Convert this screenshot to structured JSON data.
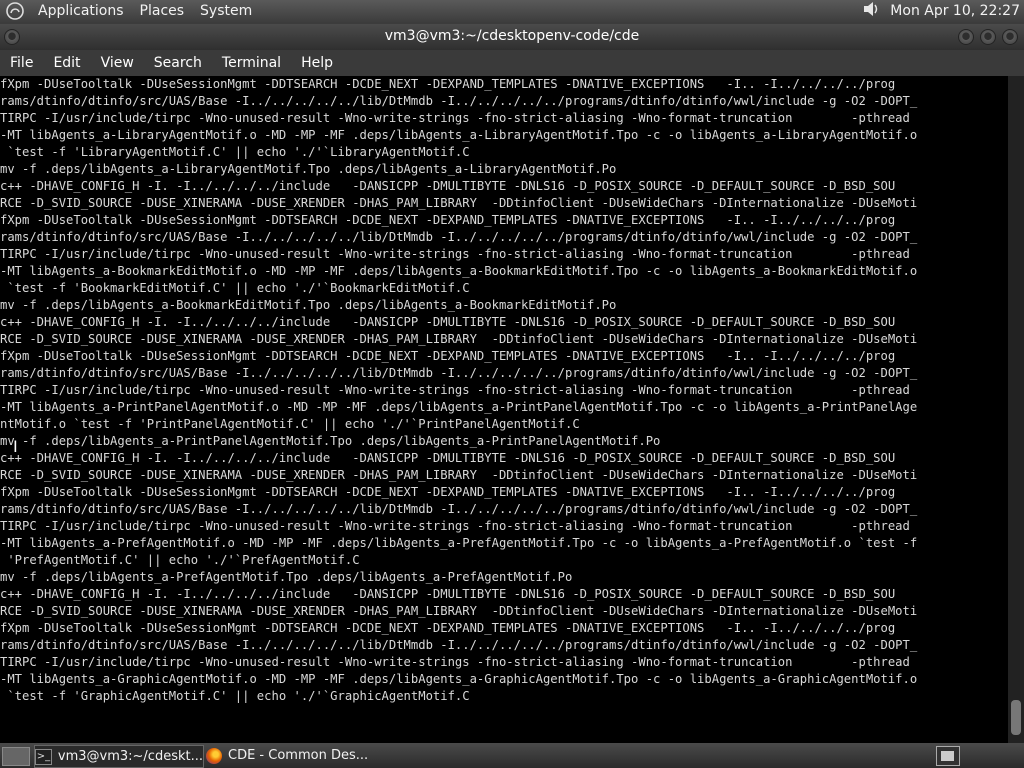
{
  "top_panel": {
    "menus": [
      "Applications",
      "Places",
      "System"
    ],
    "clock": "Mon Apr 10, 22:27"
  },
  "window": {
    "title": "vm3@vm3:~/cdesktopenv-code/cde",
    "menubar": [
      "File",
      "Edit",
      "View",
      "Search",
      "Terminal",
      "Help"
    ]
  },
  "terminal": {
    "lines": [
      "fXpm -DUseTooltalk -DUseSessionMgmt -DDTSEARCH -DCDE_NEXT -DEXPAND_TEMPLATES -DNATIVE_EXCEPTIONS   -I.. -I../../../../prog",
      "rams/dtinfo/dtinfo/src/UAS/Base -I../../../../../lib/DtMmdb -I../../../../../programs/dtinfo/dtinfo/wwl/include -g -O2 -DOPT_",
      "TIRPC -I/usr/include/tirpc -Wno-unused-result -Wno-write-strings -fno-strict-aliasing -Wno-format-truncation        -pthread",
      "-MT libAgents_a-LibraryAgentMotif.o -MD -MP -MF .deps/libAgents_a-LibraryAgentMotif.Tpo -c -o libAgents_a-LibraryAgentMotif.o",
      " `test -f 'LibraryAgentMotif.C' || echo './'`LibraryAgentMotif.C",
      "mv -f .deps/libAgents_a-LibraryAgentMotif.Tpo .deps/libAgents_a-LibraryAgentMotif.Po",
      "c++ -DHAVE_CONFIG_H -I. -I../../../../include   -DANSICPP -DMULTIBYTE -DNLS16 -D_POSIX_SOURCE -D_DEFAULT_SOURCE -D_BSD_SOU",
      "RCE -D_SVID_SOURCE -DUSE_XINERAMA -DUSE_XRENDER -DHAS_PAM_LIBRARY  -DDtinfoClient -DUseWideChars -DInternationalize -DUseMoti",
      "fXpm -DUseTooltalk -DUseSessionMgmt -DDTSEARCH -DCDE_NEXT -DEXPAND_TEMPLATES -DNATIVE_EXCEPTIONS   -I.. -I../../../../prog",
      "rams/dtinfo/dtinfo/src/UAS/Base -I../../../../../lib/DtMmdb -I../../../../../programs/dtinfo/dtinfo/wwl/include -g -O2 -DOPT_",
      "TIRPC -I/usr/include/tirpc -Wno-unused-result -Wno-write-strings -fno-strict-aliasing -Wno-format-truncation        -pthread",
      "-MT libAgents_a-BookmarkEditMotif.o -MD -MP -MF .deps/libAgents_a-BookmarkEditMotif.Tpo -c -o libAgents_a-BookmarkEditMotif.o",
      " `test -f 'BookmarkEditMotif.C' || echo './'`BookmarkEditMotif.C",
      "mv -f .deps/libAgents_a-BookmarkEditMotif.Tpo .deps/libAgents_a-BookmarkEditMotif.Po",
      "c++ -DHAVE_CONFIG_H -I. -I../../../../include   -DANSICPP -DMULTIBYTE -DNLS16 -D_POSIX_SOURCE -D_DEFAULT_SOURCE -D_BSD_SOU",
      "RCE -D_SVID_SOURCE -DUSE_XINERAMA -DUSE_XRENDER -DHAS_PAM_LIBRARY  -DDtinfoClient -DUseWideChars -DInternationalize -DUseMoti",
      "fXpm -DUseTooltalk -DUseSessionMgmt -DDTSEARCH -DCDE_NEXT -DEXPAND_TEMPLATES -DNATIVE_EXCEPTIONS   -I.. -I../../../../prog",
      "rams/dtinfo/dtinfo/src/UAS/Base -I../../../../../lib/DtMmdb -I../../../../../programs/dtinfo/dtinfo/wwl/include -g -O2 -DOPT_",
      "TIRPC -I/usr/include/tirpc -Wno-unused-result -Wno-write-strings -fno-strict-aliasing -Wno-format-truncation        -pthread",
      "-MT libAgents_a-PrintPanelAgentMotif.o -MD -MP -MF .deps/libAgents_a-PrintPanelAgentMotif.Tpo -c -o libAgents_a-PrintPanelAge",
      "ntMotif.o `test -f 'PrintPanelAgentMotif.C' || echo './'`PrintPanelAgentMotif.C",
      "mv -f .deps/libAgents_a-PrintPanelAgentMotif.Tpo .deps/libAgents_a-PrintPanelAgentMotif.Po",
      "c++ -DHAVE_CONFIG_H -I. -I../../../../include   -DANSICPP -DMULTIBYTE -DNLS16 -D_POSIX_SOURCE -D_DEFAULT_SOURCE -D_BSD_SOU",
      "RCE -D_SVID_SOURCE -DUSE_XINERAMA -DUSE_XRENDER -DHAS_PAM_LIBRARY  -DDtinfoClient -DUseWideChars -DInternationalize -DUseMoti",
      "fXpm -DUseTooltalk -DUseSessionMgmt -DDTSEARCH -DCDE_NEXT -DEXPAND_TEMPLATES -DNATIVE_EXCEPTIONS   -I.. -I../../../../prog",
      "rams/dtinfo/dtinfo/src/UAS/Base -I../../../../../lib/DtMmdb -I../../../../../programs/dtinfo/dtinfo/wwl/include -g -O2 -DOPT_",
      "TIRPC -I/usr/include/tirpc -Wno-unused-result -Wno-write-strings -fno-strict-aliasing -Wno-format-truncation        -pthread",
      "-MT libAgents_a-PrefAgentMotif.o -MD -MP -MF .deps/libAgents_a-PrefAgentMotif.Tpo -c -o libAgents_a-PrefAgentMotif.o `test -f",
      " 'PrefAgentMotif.C' || echo './'`PrefAgentMotif.C",
      "mv -f .deps/libAgents_a-PrefAgentMotif.Tpo .deps/libAgents_a-PrefAgentMotif.Po",
      "c++ -DHAVE_CONFIG_H -I. -I../../../../include   -DANSICPP -DMULTIBYTE -DNLS16 -D_POSIX_SOURCE -D_DEFAULT_SOURCE -D_BSD_SOU",
      "RCE -D_SVID_SOURCE -DUSE_XINERAMA -DUSE_XRENDER -DHAS_PAM_LIBRARY  -DDtinfoClient -DUseWideChars -DInternationalize -DUseMoti",
      "fXpm -DUseTooltalk -DUseSessionMgmt -DDTSEARCH -DCDE_NEXT -DEXPAND_TEMPLATES -DNATIVE_EXCEPTIONS   -I.. -I../../../../prog",
      "rams/dtinfo/dtinfo/src/UAS/Base -I../../../../../lib/DtMmdb -I../../../../../programs/dtinfo/dtinfo/wwl/include -g -O2 -DOPT_",
      "TIRPC -I/usr/include/tirpc -Wno-unused-result -Wno-write-strings -fno-strict-aliasing -Wno-format-truncation        -pthread",
      "-MT libAgents_a-GraphicAgentMotif.o -MD -MP -MF .deps/libAgents_a-GraphicAgentMotif.Tpo -c -o libAgents_a-GraphicAgentMotif.o",
      " `test -f 'GraphicAgentMotif.C' || echo './'`GraphicAgentMotif.C"
    ]
  },
  "taskbar": {
    "tasks": [
      {
        "label": "vm3@vm3:~/cdeskt...",
        "icon": "terminal-icon"
      },
      {
        "label": "CDE - Common Des...",
        "icon": "firefox-icon"
      }
    ]
  },
  "colors": {
    "terminal_bg": "#000000",
    "terminal_fg": "#d8d8d8",
    "panel_bg": "#3c3c3c"
  }
}
